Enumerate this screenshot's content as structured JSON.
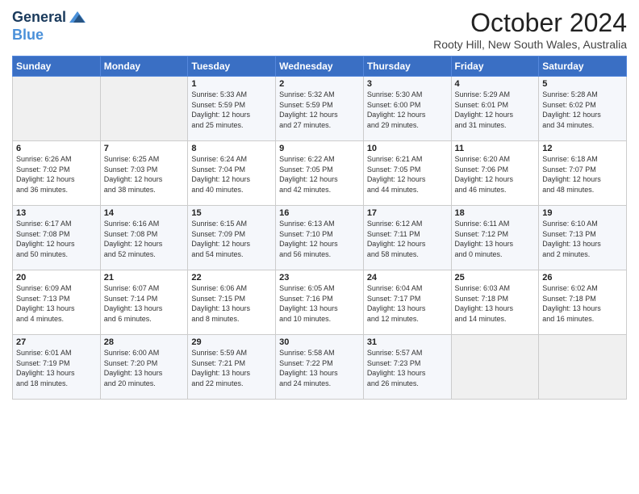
{
  "header": {
    "logo_line1": "General",
    "logo_line2": "Blue",
    "title": "October 2024",
    "subtitle": "Rooty Hill, New South Wales, Australia"
  },
  "days_of_week": [
    "Sunday",
    "Monday",
    "Tuesday",
    "Wednesday",
    "Thursday",
    "Friday",
    "Saturday"
  ],
  "weeks": [
    [
      {
        "day": "",
        "info": ""
      },
      {
        "day": "",
        "info": ""
      },
      {
        "day": "1",
        "info": "Sunrise: 5:33 AM\nSunset: 5:59 PM\nDaylight: 12 hours\nand 25 minutes."
      },
      {
        "day": "2",
        "info": "Sunrise: 5:32 AM\nSunset: 5:59 PM\nDaylight: 12 hours\nand 27 minutes."
      },
      {
        "day": "3",
        "info": "Sunrise: 5:30 AM\nSunset: 6:00 PM\nDaylight: 12 hours\nand 29 minutes."
      },
      {
        "day": "4",
        "info": "Sunrise: 5:29 AM\nSunset: 6:01 PM\nDaylight: 12 hours\nand 31 minutes."
      },
      {
        "day": "5",
        "info": "Sunrise: 5:28 AM\nSunset: 6:02 PM\nDaylight: 12 hours\nand 34 minutes."
      }
    ],
    [
      {
        "day": "6",
        "info": "Sunrise: 6:26 AM\nSunset: 7:02 PM\nDaylight: 12 hours\nand 36 minutes."
      },
      {
        "day": "7",
        "info": "Sunrise: 6:25 AM\nSunset: 7:03 PM\nDaylight: 12 hours\nand 38 minutes."
      },
      {
        "day": "8",
        "info": "Sunrise: 6:24 AM\nSunset: 7:04 PM\nDaylight: 12 hours\nand 40 minutes."
      },
      {
        "day": "9",
        "info": "Sunrise: 6:22 AM\nSunset: 7:05 PM\nDaylight: 12 hours\nand 42 minutes."
      },
      {
        "day": "10",
        "info": "Sunrise: 6:21 AM\nSunset: 7:05 PM\nDaylight: 12 hours\nand 44 minutes."
      },
      {
        "day": "11",
        "info": "Sunrise: 6:20 AM\nSunset: 7:06 PM\nDaylight: 12 hours\nand 46 minutes."
      },
      {
        "day": "12",
        "info": "Sunrise: 6:18 AM\nSunset: 7:07 PM\nDaylight: 12 hours\nand 48 minutes."
      }
    ],
    [
      {
        "day": "13",
        "info": "Sunrise: 6:17 AM\nSunset: 7:08 PM\nDaylight: 12 hours\nand 50 minutes."
      },
      {
        "day": "14",
        "info": "Sunrise: 6:16 AM\nSunset: 7:08 PM\nDaylight: 12 hours\nand 52 minutes."
      },
      {
        "day": "15",
        "info": "Sunrise: 6:15 AM\nSunset: 7:09 PM\nDaylight: 12 hours\nand 54 minutes."
      },
      {
        "day": "16",
        "info": "Sunrise: 6:13 AM\nSunset: 7:10 PM\nDaylight: 12 hours\nand 56 minutes."
      },
      {
        "day": "17",
        "info": "Sunrise: 6:12 AM\nSunset: 7:11 PM\nDaylight: 12 hours\nand 58 minutes."
      },
      {
        "day": "18",
        "info": "Sunrise: 6:11 AM\nSunset: 7:12 PM\nDaylight: 13 hours\nand 0 minutes."
      },
      {
        "day": "19",
        "info": "Sunrise: 6:10 AM\nSunset: 7:13 PM\nDaylight: 13 hours\nand 2 minutes."
      }
    ],
    [
      {
        "day": "20",
        "info": "Sunrise: 6:09 AM\nSunset: 7:13 PM\nDaylight: 13 hours\nand 4 minutes."
      },
      {
        "day": "21",
        "info": "Sunrise: 6:07 AM\nSunset: 7:14 PM\nDaylight: 13 hours\nand 6 minutes."
      },
      {
        "day": "22",
        "info": "Sunrise: 6:06 AM\nSunset: 7:15 PM\nDaylight: 13 hours\nand 8 minutes."
      },
      {
        "day": "23",
        "info": "Sunrise: 6:05 AM\nSunset: 7:16 PM\nDaylight: 13 hours\nand 10 minutes."
      },
      {
        "day": "24",
        "info": "Sunrise: 6:04 AM\nSunset: 7:17 PM\nDaylight: 13 hours\nand 12 minutes."
      },
      {
        "day": "25",
        "info": "Sunrise: 6:03 AM\nSunset: 7:18 PM\nDaylight: 13 hours\nand 14 minutes."
      },
      {
        "day": "26",
        "info": "Sunrise: 6:02 AM\nSunset: 7:18 PM\nDaylight: 13 hours\nand 16 minutes."
      }
    ],
    [
      {
        "day": "27",
        "info": "Sunrise: 6:01 AM\nSunset: 7:19 PM\nDaylight: 13 hours\nand 18 minutes."
      },
      {
        "day": "28",
        "info": "Sunrise: 6:00 AM\nSunset: 7:20 PM\nDaylight: 13 hours\nand 20 minutes."
      },
      {
        "day": "29",
        "info": "Sunrise: 5:59 AM\nSunset: 7:21 PM\nDaylight: 13 hours\nand 22 minutes."
      },
      {
        "day": "30",
        "info": "Sunrise: 5:58 AM\nSunset: 7:22 PM\nDaylight: 13 hours\nand 24 minutes."
      },
      {
        "day": "31",
        "info": "Sunrise: 5:57 AM\nSunset: 7:23 PM\nDaylight: 13 hours\nand 26 minutes."
      },
      {
        "day": "",
        "info": ""
      },
      {
        "day": "",
        "info": ""
      }
    ]
  ]
}
